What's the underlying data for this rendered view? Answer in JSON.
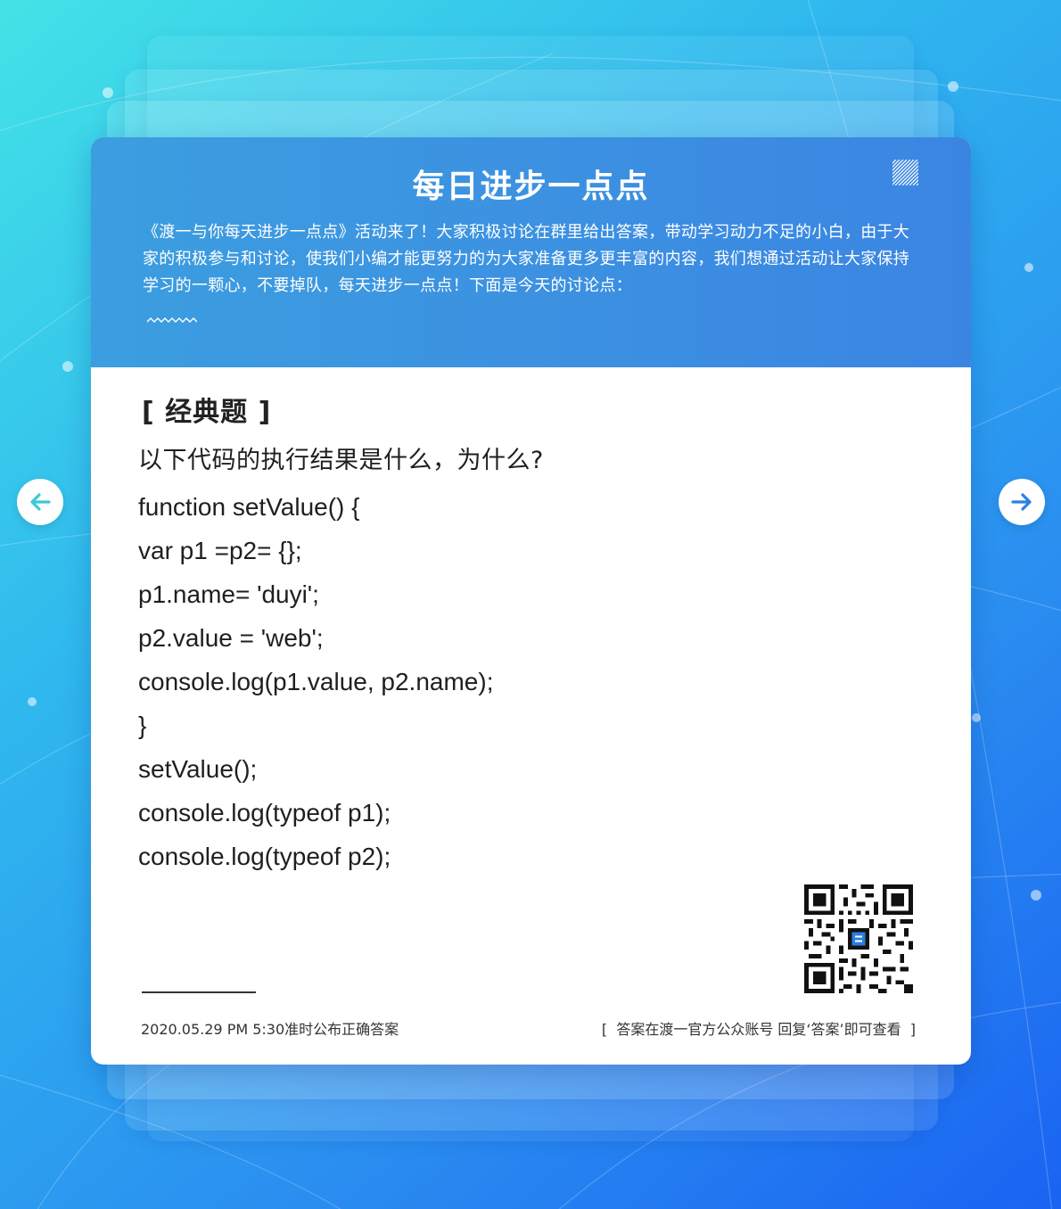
{
  "card": {
    "title": "每日进步一点点",
    "description": "《渡一与你每天进步一点点》活动来了！大家积极讨论在群里给出答案，带动学习动力不足的小白，由于大家的积极参与和讨论，使我们小编才能更努力的为大家准备更多更丰富的内容，我们想通过活动让大家保持学习的一颗心，不要掉队，每天进步一点点！下面是今天的讨论点："
  },
  "question": {
    "tag": "[ 经典题 ]",
    "prompt": "以下代码的执行结果是什么，为什么?",
    "code_lines": [
      "function setValue() {",
      "var p1 =p2= {};",
      "p1.name= 'duyi';",
      "p2.value = 'web';",
      "console.log(p1.value, p2.name);",
      "}",
      "setValue();",
      "console.log(typeof p1);",
      "console.log(typeof p2);"
    ]
  },
  "footer": {
    "publish_time": "2020.05.29  PM  5:30准时公布正确答案",
    "hint": "[  答案在渡一官方公众账号 回复‘答案’即可查看  ]"
  },
  "icons": {
    "prev": "arrow-left-icon",
    "next": "arrow-right-icon",
    "qr": "qr-code"
  },
  "colors": {
    "header": "#3b8fe1",
    "arrow_prev": "#3fc7d8",
    "arrow_next": "#2f7fe0"
  }
}
